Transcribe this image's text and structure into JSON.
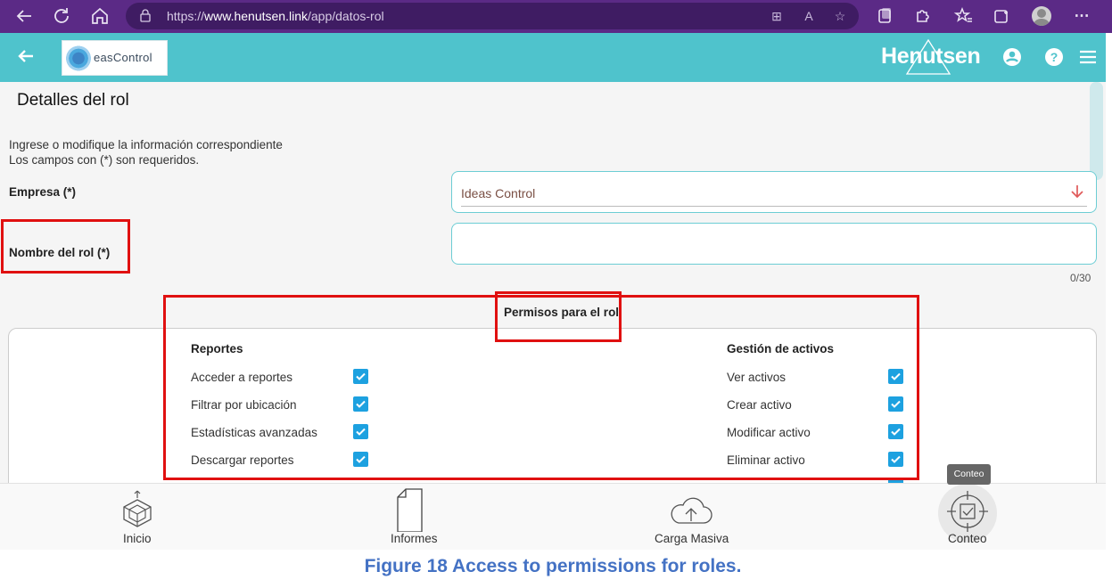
{
  "browser": {
    "url_prefix": "https://",
    "url_host": "www.henutsen.link",
    "url_path": "/app/datos-rol"
  },
  "header": {
    "logo_text": "easControl",
    "brand": "Henutsen"
  },
  "form": {
    "title": "Detalles del rol",
    "intro_line1": "Ingrese o modifique la información correspondiente",
    "intro_line2": "Los campos con (*) son requeridos.",
    "empresa_label": "Empresa (*)",
    "empresa_value": "Ideas Control",
    "rol_label": "Nombre del rol (*)",
    "rol_value": "",
    "counter": "0/30"
  },
  "permissions": {
    "title": "Permisos para el rol",
    "sections": [
      {
        "name": "Reportes",
        "items": [
          {
            "label": "Acceder a reportes",
            "checked": true
          },
          {
            "label": "Filtrar por ubicación",
            "checked": true
          },
          {
            "label": "Estadísticas avanzadas",
            "checked": true
          },
          {
            "label": "Descargar reportes",
            "checked": true
          }
        ]
      },
      {
        "name": "Gestión de activos",
        "items": [
          {
            "label": "Ver activos",
            "checked": true
          },
          {
            "label": "Crear activo",
            "checked": true
          },
          {
            "label": "Modificar activo",
            "checked": true
          },
          {
            "label": "Eliminar activo",
            "checked": true
          }
        ]
      }
    ]
  },
  "bottom_nav": {
    "items": [
      {
        "label": "Inicio"
      },
      {
        "label": "Informes"
      },
      {
        "label": "Carga Masiva"
      },
      {
        "label": "Conteo"
      }
    ],
    "tooltip": "Conteo"
  },
  "caption": "Figure 18 Access to permissions for roles.",
  "colors": {
    "browser_bar": "#5b2a86",
    "app_header": "#4fc3cc",
    "checkbox": "#1da1e0",
    "highlight": "#e01010",
    "caption": "#4472c4"
  }
}
